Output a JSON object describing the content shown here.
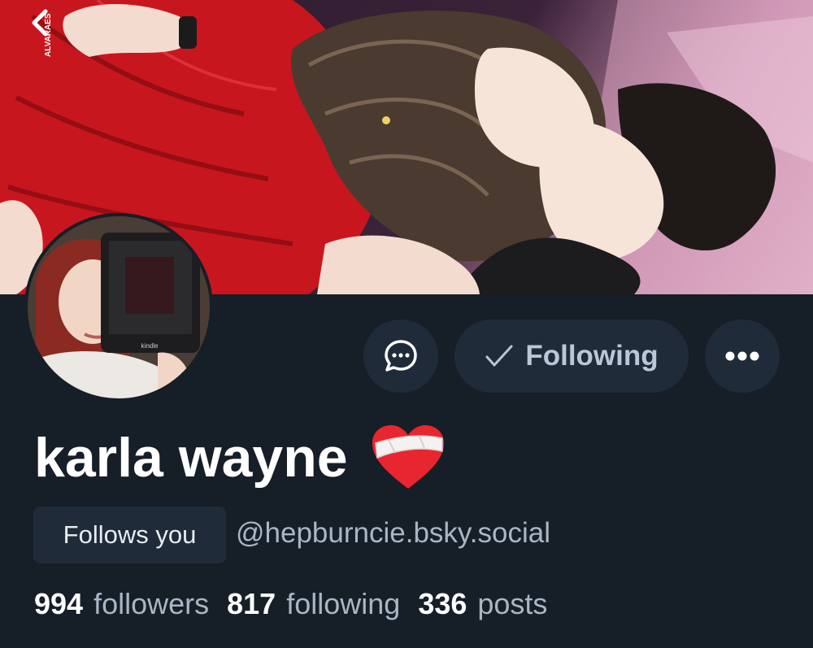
{
  "banner": {
    "watermark": "ALVARAES"
  },
  "profile": {
    "display_name": "karla wayne",
    "emoji": "❤️‍🩹",
    "follows_you_label": "Follows you",
    "handle": "@hepburncie.bsky.social"
  },
  "actions": {
    "following_label": "Following"
  },
  "stats": {
    "followers_count": "994",
    "followers_label": "followers",
    "following_count": "817",
    "following_label": "following",
    "posts_count": "336",
    "posts_label": "posts"
  },
  "colors": {
    "background": "#161e27",
    "button_bg": "#1f2b38",
    "muted_text": "#a9b6c4",
    "accent_red": "#c8161e"
  }
}
